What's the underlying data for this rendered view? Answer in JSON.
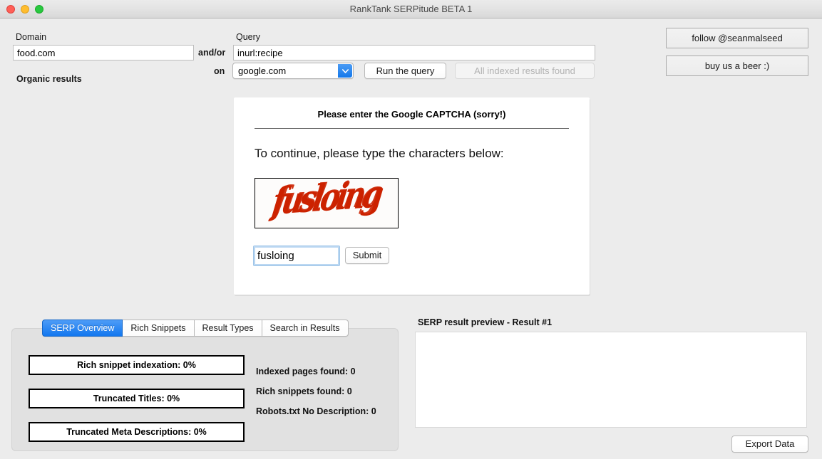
{
  "window": {
    "title": "RankTank SERPitude BETA 1",
    "traffic_lights": [
      "close-button",
      "minimize-button",
      "zoom-button"
    ]
  },
  "toolbar": {
    "domain_label": "Domain",
    "domain_value": "food.com",
    "andor_label": "and/or",
    "query_label": "Query",
    "query_value": "inurl:recipe",
    "on_label": "on",
    "engine_value": "google.com",
    "engine_options": [
      "google.com"
    ],
    "run_query_label": "Run the query",
    "status_button_label": "All indexed results found",
    "organic_results_label": "Organic results",
    "follow_label": "follow @seanmalseed",
    "beer_label": "buy us a beer :)"
  },
  "captcha": {
    "title": "Please enter the Google CAPTCHA (sorry!)",
    "instruction": "To continue, please type the characters below:",
    "image_text": "fusloing",
    "image_color": "#cc2200",
    "answer_value": "fusloing",
    "submit_label": "Submit"
  },
  "tabs": [
    {
      "label": "SERP Overview",
      "active": true
    },
    {
      "label": "Rich Snippets",
      "active": false
    },
    {
      "label": "Result Types",
      "active": false
    },
    {
      "label": "Search in Results",
      "active": false
    }
  ],
  "overview": {
    "metrics": [
      "Rich snippet indexation: 0%",
      "Truncated Titles: 0%",
      "Truncated Meta Descriptions: 0%"
    ],
    "stats": [
      "Indexed pages found: 0",
      "Rich snippets found: 0",
      "Robots.txt No Description: 0"
    ]
  },
  "preview": {
    "title": "SERP result preview - Result #1",
    "content": "",
    "export_label": "Export Data"
  },
  "colors": {
    "accent_blue": "#1277ef",
    "window_bg": "#ececec",
    "panel_bg": "#e1e1e1",
    "captcha_red": "#cc2200"
  }
}
